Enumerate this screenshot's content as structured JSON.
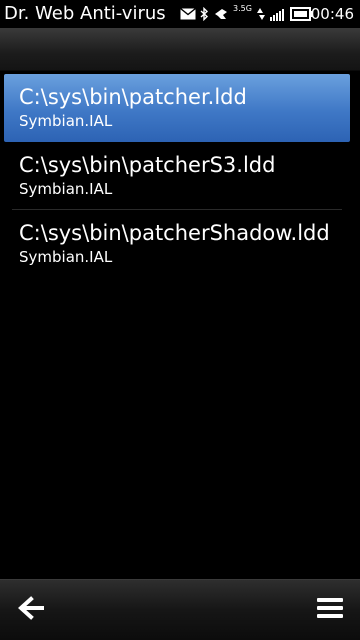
{
  "status_bar": {
    "app_title": "Dr. Web Anti-virus",
    "network_label": "3.5G",
    "clock": "00:46",
    "icons": [
      "mail-icon",
      "bluetooth-icon",
      "usb-icon",
      "network-icon",
      "signal-icon",
      "battery-icon"
    ]
  },
  "list": {
    "items": [
      {
        "path": "C:\\sys\\bin\\patcher.ldd",
        "detail": "Symbian.IAL",
        "selected": true
      },
      {
        "path": "C:\\sys\\bin\\patcherS3.ldd",
        "detail": "Symbian.IAL",
        "selected": false
      },
      {
        "path": "C:\\sys\\bin\\patcherShadow.ldd",
        "detail": "Symbian.IAL",
        "selected": false
      }
    ]
  },
  "toolbar": {
    "back_icon": "back-arrow-icon",
    "menu_icon": "menu-icon"
  },
  "colors": {
    "selection": "#3f78c6",
    "background": "#000000",
    "text": "#ffffff"
  }
}
